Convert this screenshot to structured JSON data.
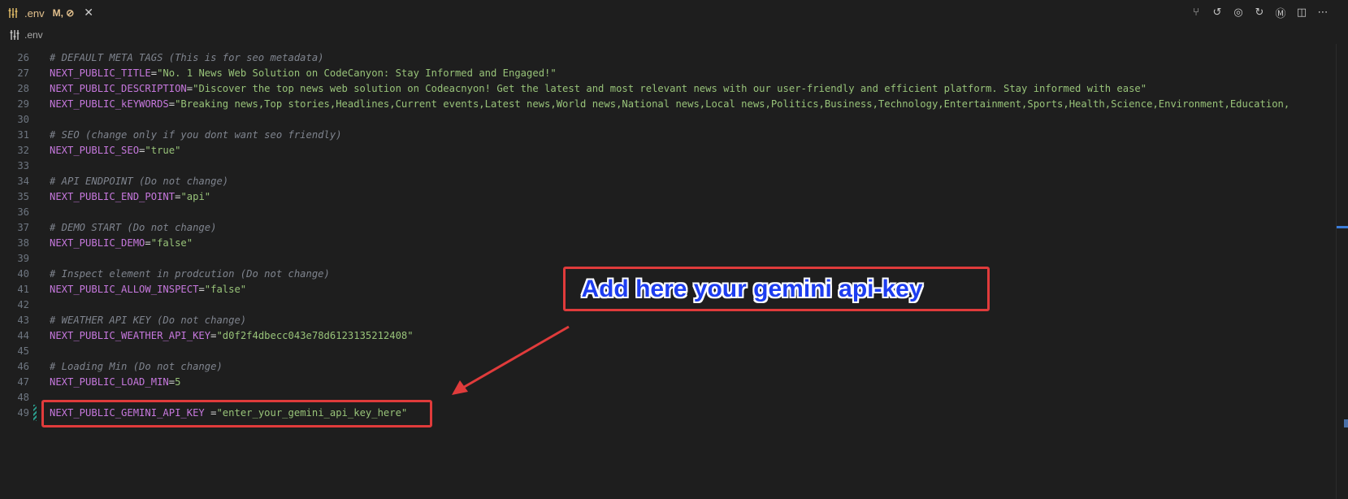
{
  "tab": {
    "name": ".env",
    "status": "M, ⊘",
    "close": "✕",
    "file_icon": "settings-sliders-icon"
  },
  "actions": [
    {
      "name": "source-control-icon",
      "glyph": "⑂"
    },
    {
      "name": "go-back-icon",
      "glyph": "↺"
    },
    {
      "name": "commit-node-icon",
      "glyph": "◎"
    },
    {
      "name": "go-forward-icon",
      "glyph": "↻"
    },
    {
      "name": "merge-icon",
      "glyph": "Ⓜ"
    },
    {
      "name": "split-editor-icon",
      "glyph": "◫"
    },
    {
      "name": "more-actions-icon",
      "glyph": "⋯"
    }
  ],
  "breadcrumb": {
    "file": ".env"
  },
  "lines": [
    {
      "n": "26",
      "parts": [
        {
          "t": "cmt",
          "v": "# DEFAULT META TAGS (This is for seo metadata)"
        }
      ]
    },
    {
      "n": "27",
      "parts": [
        {
          "t": "key",
          "v": "NEXT_PUBLIC_TITLE"
        },
        {
          "t": "code",
          "v": "="
        },
        {
          "t": "str",
          "v": "\"No. 1 News Web Solution on CodeCanyon: Stay Informed and Engaged!\""
        }
      ]
    },
    {
      "n": "28",
      "parts": [
        {
          "t": "key",
          "v": "NEXT_PUBLIC_DESCRIPTION"
        },
        {
          "t": "code",
          "v": "="
        },
        {
          "t": "str",
          "v": "\"Discover the top news web solution on Codeacnyon! Get the latest and most relevant news with our user-friendly and efficient platform. Stay informed with ease\""
        }
      ]
    },
    {
      "n": "29",
      "parts": [
        {
          "t": "key",
          "v": "NEXT_PUBLIC_kEYWORDS"
        },
        {
          "t": "code",
          "v": "="
        },
        {
          "t": "str",
          "v": "\"Breaking news,Top stories,Headlines,Current events,Latest news,World news,National news,Local news,Politics,Business,Technology,Entertainment,Sports,Health,Science,Environment,Education,"
        }
      ]
    },
    {
      "n": "30",
      "parts": []
    },
    {
      "n": "31",
      "parts": [
        {
          "t": "cmt",
          "v": "# SEO (change only if you dont want seo friendly)"
        }
      ]
    },
    {
      "n": "32",
      "parts": [
        {
          "t": "key",
          "v": "NEXT_PUBLIC_SEO"
        },
        {
          "t": "code",
          "v": "="
        },
        {
          "t": "str",
          "v": "\"true\""
        }
      ]
    },
    {
      "n": "33",
      "parts": []
    },
    {
      "n": "34",
      "parts": [
        {
          "t": "cmt",
          "v": "# API ENDPOINT (Do not change)"
        }
      ]
    },
    {
      "n": "35",
      "parts": [
        {
          "t": "key",
          "v": "NEXT_PUBLIC_END_POINT"
        },
        {
          "t": "code",
          "v": "="
        },
        {
          "t": "str",
          "v": "\"api\""
        }
      ]
    },
    {
      "n": "36",
      "parts": []
    },
    {
      "n": "37",
      "parts": [
        {
          "t": "cmt",
          "v": "# DEMO START (Do not change)"
        }
      ]
    },
    {
      "n": "38",
      "parts": [
        {
          "t": "key",
          "v": "NEXT_PUBLIC_DEMO"
        },
        {
          "t": "code",
          "v": "="
        },
        {
          "t": "str",
          "v": "\"false\""
        }
      ]
    },
    {
      "n": "39",
      "parts": []
    },
    {
      "n": "40",
      "parts": [
        {
          "t": "cmt",
          "v": "# Inspect element in prodcution (Do not change)"
        }
      ]
    },
    {
      "n": "41",
      "parts": [
        {
          "t": "key",
          "v": "NEXT_PUBLIC_ALLOW_INSPECT"
        },
        {
          "t": "code",
          "v": "="
        },
        {
          "t": "str",
          "v": "\"false\""
        }
      ]
    },
    {
      "n": "42",
      "parts": []
    },
    {
      "n": "43",
      "parts": [
        {
          "t": "cmt",
          "v": "# WEATHER API KEY (Do not change)"
        }
      ]
    },
    {
      "n": "44",
      "parts": [
        {
          "t": "key",
          "v": "NEXT_PUBLIC_WEATHER_API_KEY"
        },
        {
          "t": "code",
          "v": "="
        },
        {
          "t": "str",
          "v": "\"d0f2f4dbecc043e78d6123135212408\""
        }
      ]
    },
    {
      "n": "45",
      "parts": []
    },
    {
      "n": "46",
      "parts": [
        {
          "t": "cmt",
          "v": "# Loading Min (Do not change)"
        }
      ]
    },
    {
      "n": "47",
      "parts": [
        {
          "t": "key",
          "v": "NEXT_PUBLIC_LOAD_MIN"
        },
        {
          "t": "code",
          "v": "="
        },
        {
          "t": "num",
          "v": "5"
        }
      ]
    },
    {
      "n": "48",
      "parts": []
    },
    {
      "n": "49",
      "parts": [
        {
          "t": "key",
          "v": "NEXT_PUBLIC_GEMINI_API_KEY"
        },
        {
          "t": "code",
          "v": " ="
        },
        {
          "t": "str",
          "v": "\"enter_your_gemini_api_key_here\""
        }
      ]
    }
  ],
  "annotation": {
    "text": "Add here your gemini api-key",
    "color": "#e03b3b"
  }
}
